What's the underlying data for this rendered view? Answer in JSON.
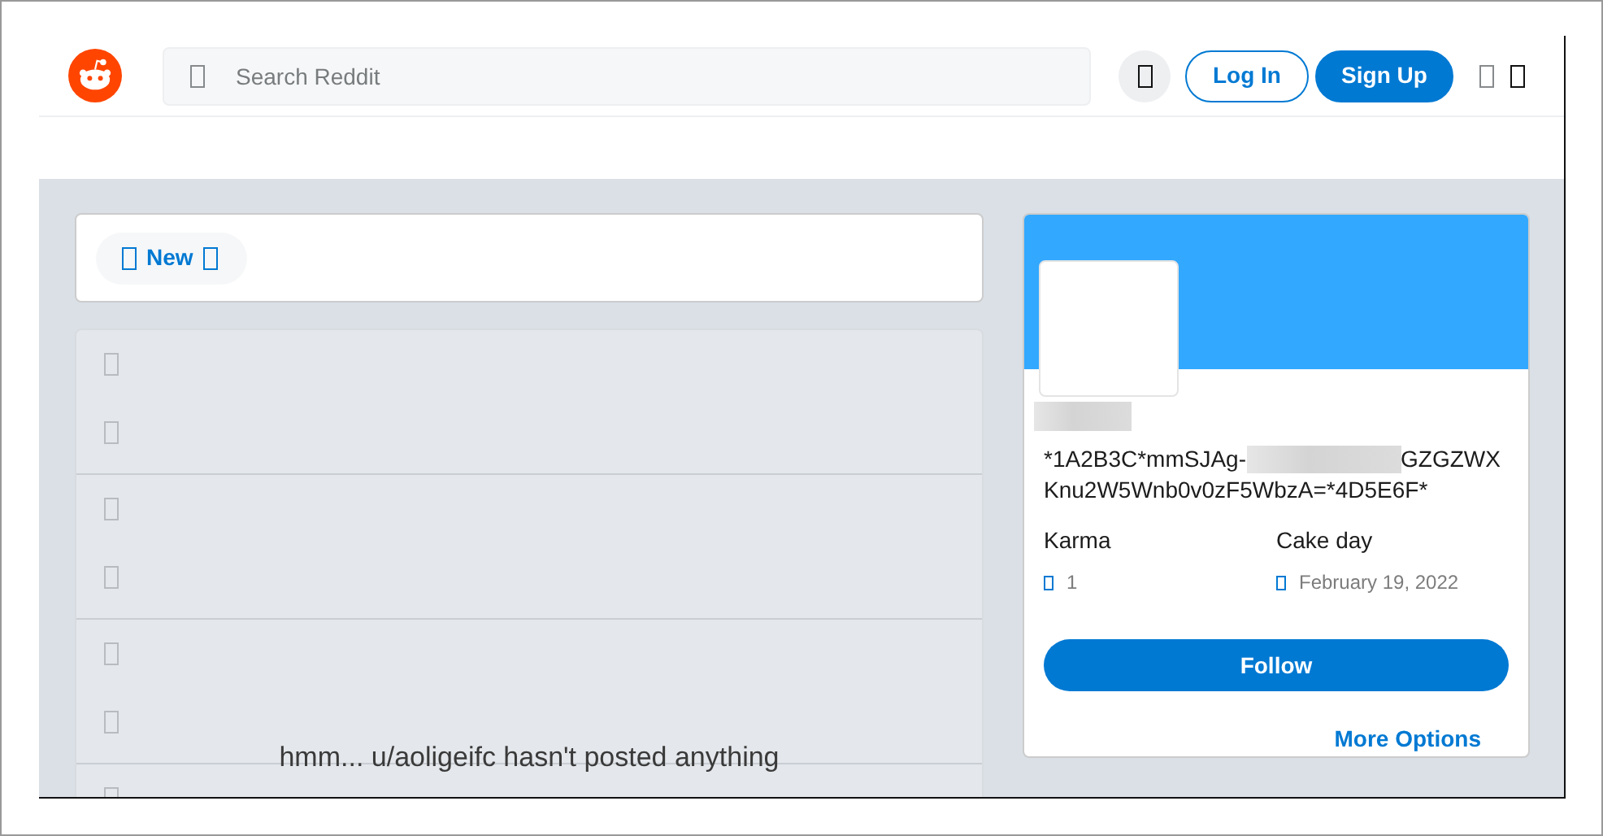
{
  "header": {
    "search": {
      "placeholder": "Search Reddit"
    },
    "buttons": [
      {
        "label": "Log In",
        "kind": "outline"
      },
      {
        "label": "Sign Up",
        "kind": "solid"
      }
    ]
  },
  "sort": {
    "label": "New"
  },
  "feed": {
    "rows": [
      {
        "kind": "skeleton"
      },
      {
        "kind": "skeleton"
      },
      {
        "kind": "skeleton"
      },
      {
        "kind": "skeleton_cut"
      }
    ],
    "empty_message": "hmm... u/aoligeifc hasn't posted anything"
  },
  "profile": {
    "key_line_1_start": "*1A2B3C*mmSJAg-",
    "key_line_1_end": "GZGZWX",
    "key_line_2": "Knu2W5Wnb0v0zF5WbzA=*4D5E6F*",
    "stats": [
      {
        "label": "Karma",
        "value": "1"
      },
      {
        "label": "Cake day",
        "value": "February 19, 2022"
      }
    ],
    "follow": "Follow",
    "more_options": "More Options"
  }
}
